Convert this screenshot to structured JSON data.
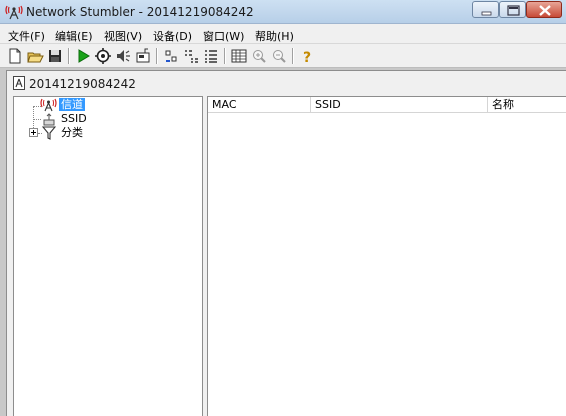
{
  "window": {
    "title": "Network Stumbler - 20141219084242",
    "controls": {
      "minimize": "minimize-icon",
      "maximize": "maximize-icon",
      "close": "close-icon"
    }
  },
  "menu": [
    {
      "label": "文件(F)"
    },
    {
      "label": "编辑(E)"
    },
    {
      "label": "视图(V)"
    },
    {
      "label": "设备(D)"
    },
    {
      "label": "窗口(W)"
    },
    {
      "label": "帮助(H)"
    }
  ],
  "toolbar": {
    "buttons": [
      "new-icon",
      "open-icon",
      "save-icon",
      "play-icon",
      "auto-config-icon",
      "speaker-icon",
      "device-icon",
      "small-icons-icon",
      "list-icon",
      "details-icon",
      "grid-icon",
      "zoom-in-icon",
      "zoom-out-icon",
      "help-icon"
    ]
  },
  "document": {
    "title": "20141219084242"
  },
  "tree": {
    "nodes": [
      {
        "label": "信道",
        "icon": "antenna-icon",
        "selected": true
      },
      {
        "label": "SSID",
        "icon": "ssid-icon",
        "selected": false
      },
      {
        "label": "分类",
        "icon": "filter-icon",
        "selected": false
      }
    ]
  },
  "list": {
    "columns": [
      {
        "label": "MAC"
      },
      {
        "label": "SSID"
      },
      {
        "label": "名称"
      }
    ]
  },
  "colors": {
    "titlebar": "#c2d7ee",
    "selection": "#3399ff",
    "close_button": "#c74a37",
    "play_green": "#1aa31a"
  }
}
